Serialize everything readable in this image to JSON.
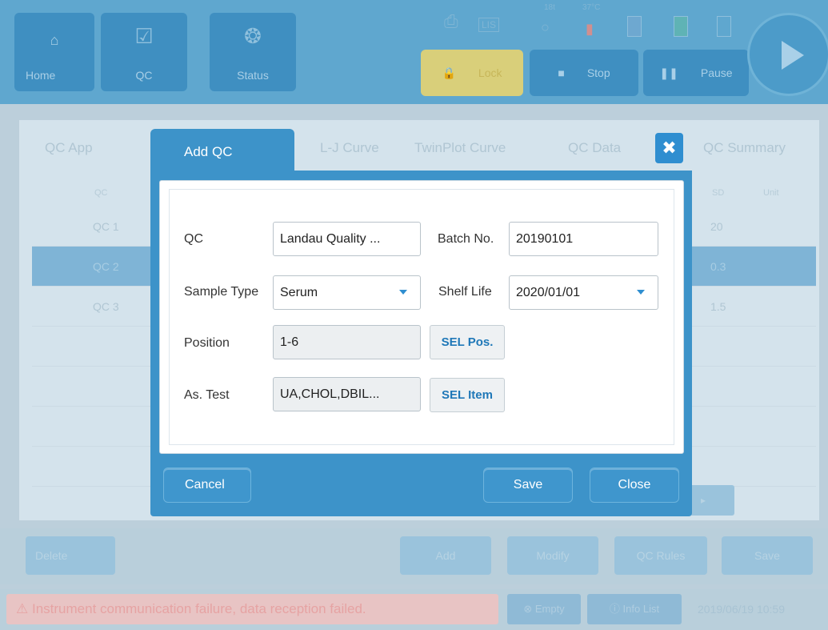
{
  "topbar": {
    "nav": [
      {
        "label": "Home",
        "icon": "home-icon"
      },
      {
        "label": "QC",
        "icon": "shield-check-icon"
      },
      {
        "label": "Status",
        "icon": "rotor-icon"
      }
    ],
    "lis_label": "LIS",
    "temp_labels": [
      "18t",
      "37°C"
    ],
    "lock_label": "Lock",
    "stop_label": "Stop",
    "pause_label": "Pause"
  },
  "tabs": [
    "QC App",
    "L-J Curve",
    "TwinPlot Curve",
    "QC Data",
    "QC Summary"
  ],
  "table": {
    "header_left": "QC",
    "header_sd": "SD",
    "header_unit": "Unit",
    "rows": [
      {
        "qc": "QC 1",
        "sd": "20"
      },
      {
        "qc": "QC 2",
        "sd": "0.3"
      },
      {
        "qc": "QC 3",
        "sd": "1.5"
      }
    ]
  },
  "bottom_buttons": [
    "Delete",
    "Add",
    "Modify",
    "QC Rules",
    "Save"
  ],
  "status": {
    "alarm": "Instrument communication failure, data reception failed.",
    "empty_label": "Empty",
    "info_label": "Info List",
    "clock": "2019/06/19 10:59"
  },
  "dialog": {
    "title": "Add QC",
    "qc_label": "QC",
    "qc_value": "Landau Quality ...",
    "batch_label": "Batch No.",
    "batch_value": "20190101",
    "sample_type_label": "Sample Type",
    "sample_type_value": "Serum",
    "shelf_life_label": "Shelf Life",
    "shelf_life_value": "2020/01/01",
    "position_label": "Position",
    "position_value": "1-6",
    "sel_pos_label": "SEL Pos.",
    "as_test_label": "As. Test",
    "as_test_value": "UA,CHOL,DBIL...",
    "sel_item_label": "SEL Item",
    "cancel_label": "Cancel",
    "save_label": "Save",
    "close_label": "Close"
  }
}
